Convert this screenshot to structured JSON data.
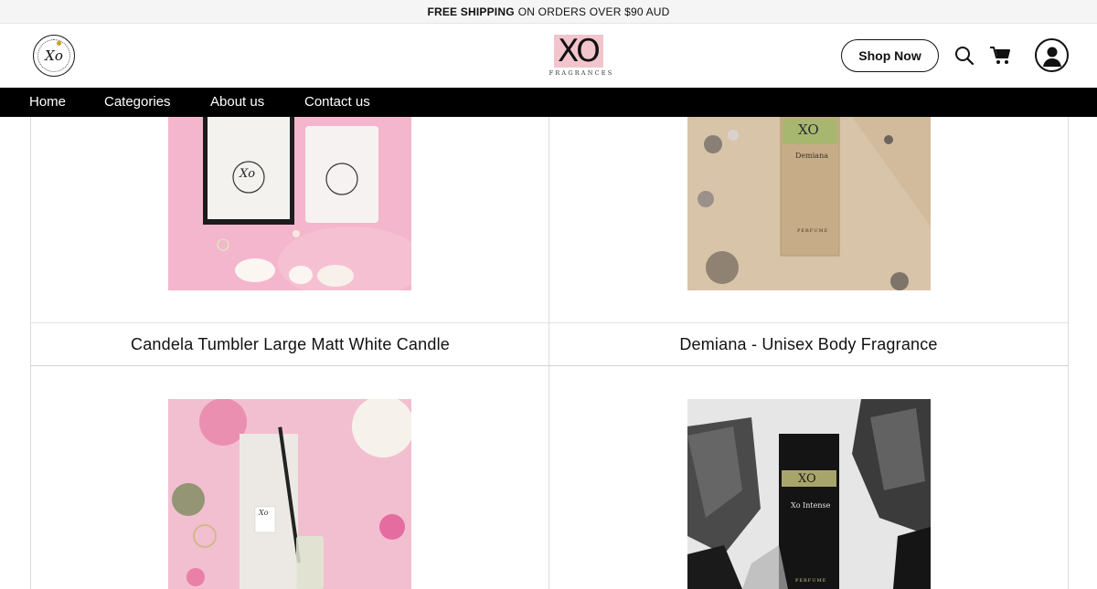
{
  "announcement": {
    "bold": "FREE SHIPPING",
    "rest": "ON ORDERS OVER $90 AUD"
  },
  "header": {
    "seal_text": "Xo",
    "brand_mark": "XO",
    "brand_sub": "FRAGRANCES",
    "shop_button": "Shop Now",
    "icons": [
      "search-icon",
      "cart-icon",
      "account-icon"
    ]
  },
  "nav": {
    "items": [
      "Home",
      "Categories",
      "About us",
      "Contact us"
    ]
  },
  "products": [
    {
      "title": "Candela Tumbler Large Matt White Candle",
      "image_label": "Xo"
    },
    {
      "title": "Demiana - Unisex Body Fragrance",
      "image_label": "XO",
      "box_name": "Demiana",
      "box_type": "PERFUME"
    },
    {
      "title": "",
      "image_label": "Xo"
    },
    {
      "title": "",
      "image_label": "XO",
      "box_name": "Xo Intense",
      "box_type": "PERFUME"
    }
  ],
  "colors": {
    "nav_bg": "#000000",
    "brand_pink": "#f2c5cc",
    "candle_bg": "#f4b6cc",
    "sand_bg": "#d8c4a8"
  }
}
